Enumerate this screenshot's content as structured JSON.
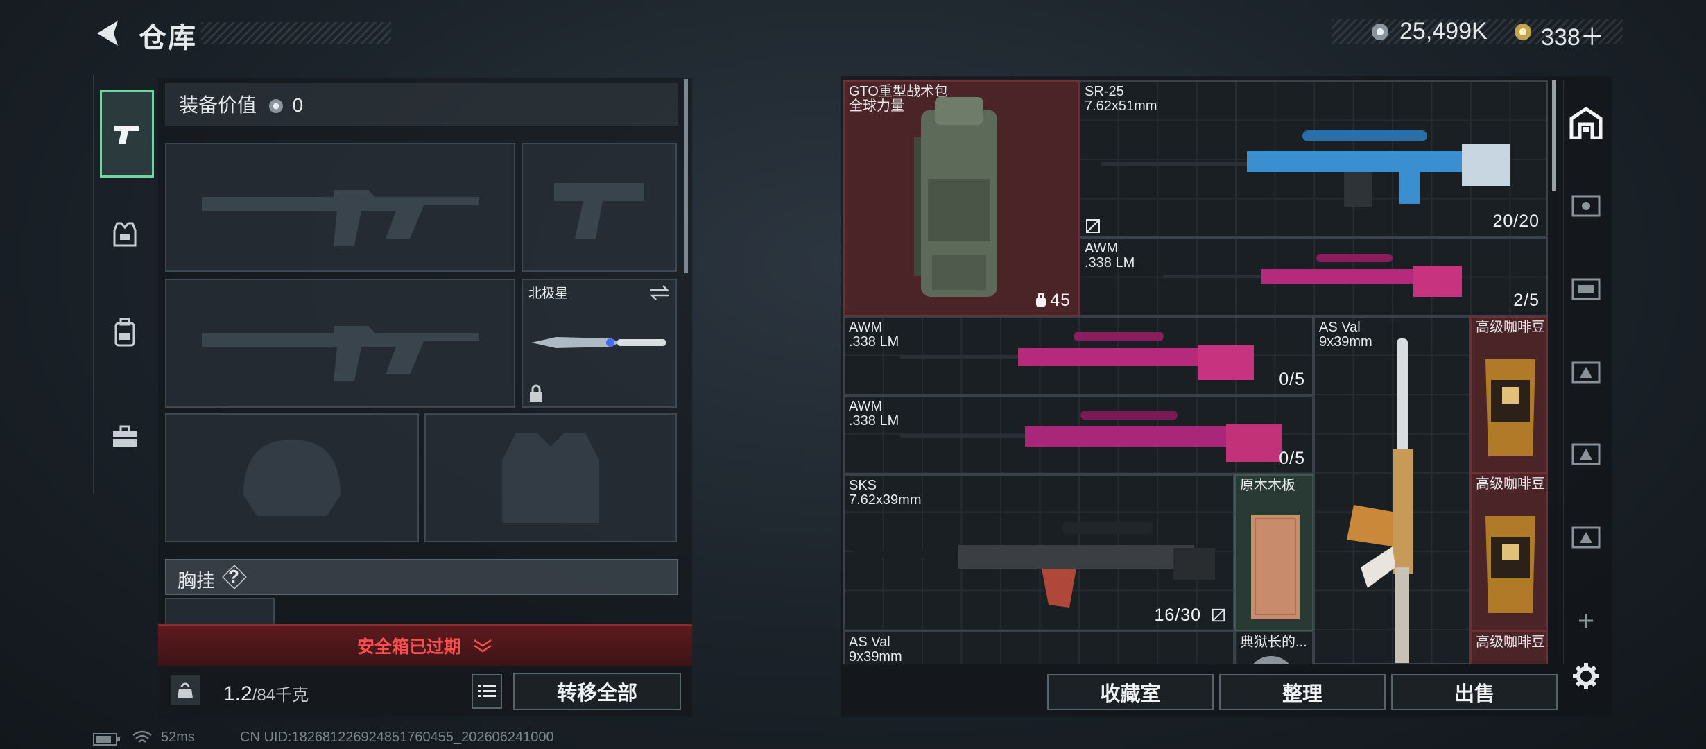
{
  "header": {
    "title": "仓库",
    "silver": "25,499K",
    "gold": "338＋"
  },
  "loadout": {
    "equip_value_label": "装备价值",
    "equip_value": "0",
    "melee_name": "北极星",
    "chest_label": "胸挂",
    "chest_help": "?",
    "safebox_status": "安全箱已过期",
    "weight_current": "1.2",
    "weight_max": "/84千克",
    "transfer_all": "转移全部"
  },
  "stash": {
    "items": [
      {
        "name": "GTO重型战术包",
        "sub": "全球力量",
        "count": "45"
      },
      {
        "name": "SR-25",
        "sub": "7.62x51mm",
        "count": "20/20"
      },
      {
        "name": "AWM",
        "sub": ".338 LM",
        "count": "2/5"
      },
      {
        "name": "AWM",
        "sub": ".338 LM",
        "count": "0/5"
      },
      {
        "name": "AWM",
        "sub": ".338 LM",
        "count": "0/5"
      },
      {
        "name": "AS Val",
        "sub": "9x39mm"
      },
      {
        "name": "高级咖啡豆"
      },
      {
        "name": "SKS",
        "sub": "7.62x39mm",
        "count": "16/30"
      },
      {
        "name": "原木木板"
      },
      {
        "name": "高级咖啡豆"
      },
      {
        "name": "AS Val",
        "sub": "9x39mm"
      },
      {
        "name": "典狱长的..."
      },
      {
        "name": "高级咖啡豆"
      }
    ],
    "buttons": {
      "collection": "收藏室",
      "sort": "整理",
      "sell": "出售"
    }
  },
  "status_bar": {
    "ping": "52ms",
    "uid": "CN UID:1826812269248517604​55_202606241000"
  },
  "colors": {
    "accent_green": "#6fd7a3",
    "alert_red": "#ff4f4f",
    "rare_red_bg": "#4a2426",
    "uncommon_green_bg": "#283a33"
  }
}
